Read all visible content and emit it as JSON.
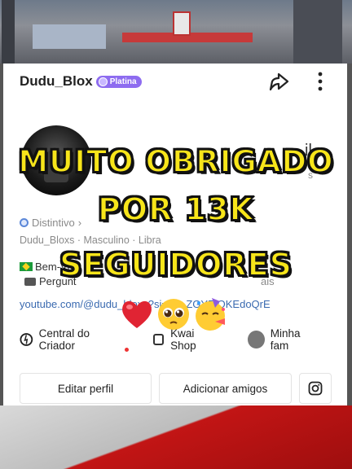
{
  "profile": {
    "username": "Dudu_Blox",
    "badge_label": "Platina",
    "stats_fragment": "il",
    "stats_sub_fragment": "s",
    "distintivo": "Distintivo",
    "info_line": "Dudu_Bloxs · Masculino · Libra",
    "bio_line1": "Bem-Vi",
    "bio_line2": "Pergunt",
    "bio_line2_tail": "ais",
    "link": "youtube.com/@dudu_bloxs?si=Zp_ZGY5rQKEdoQrE"
  },
  "actions": [
    {
      "label": "Central do Criador",
      "icon": "location-icon"
    },
    {
      "label": "Kwai Shop",
      "icon": "bag-icon"
    },
    {
      "label": "Minha fam",
      "icon": "avatar-icon"
    }
  ],
  "buttons": {
    "edit_profile": "Editar perfil",
    "add_friends": "Adicionar amigos",
    "instagram_icon": "instagram-icon"
  },
  "overlay": {
    "line1": "MUITO OBRIGADO",
    "line2": "POR 13K",
    "line3": "SEGUIDORES",
    "emojis": [
      "red-heart-emoji",
      "pleading-face-emoji",
      "party-face-emoji"
    ]
  },
  "colors": {
    "overlay_text": "#f7e51a",
    "badge": "#8e6cf0",
    "link": "#3a6ab0"
  }
}
